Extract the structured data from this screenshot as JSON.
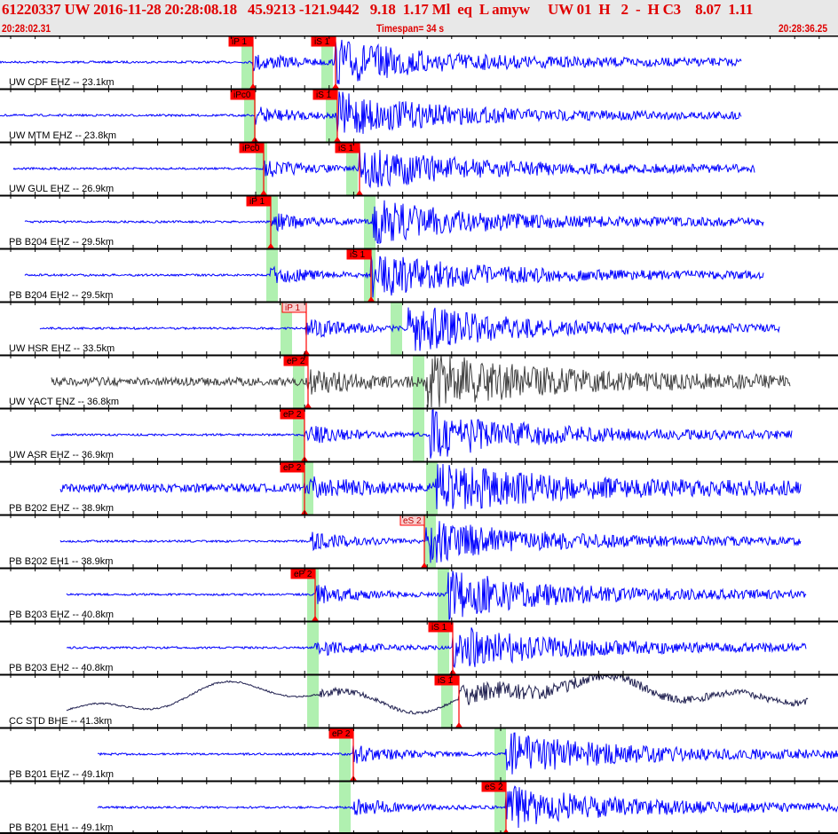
{
  "header": {
    "event_line": "61220337 UW 2016-11-28 20:28:08.18   45.9213 -121.9442   9.18  1.17 Ml  eq  L amyw     UW 01  H   2  -  H C3    8.07  1.11",
    "start_time": "20:28:02.31",
    "timespan": "Timespan=  34 s",
    "end_time": "20:28:36.25"
  },
  "colors": {
    "trace": "#0000ff",
    "trace_gray": "#404040",
    "trace_navy": "#202050",
    "pick": "#ff0000",
    "pick_light": "#f8d0d0",
    "window": "#b0f0b0",
    "header_bg": "#e8e8e8",
    "text": "#e00000"
  },
  "traces": [
    {
      "label": "UW CDF EHZ -- 23.1km",
      "picks": [
        "iP 1",
        "iS 1"
      ]
    },
    {
      "label": "UW MTM EHZ -- 23.8km",
      "picks": [
        "iPc0",
        "iS 1"
      ]
    },
    {
      "label": "UW GUL EHZ -- 26.9km",
      "picks": [
        "iPc0",
        "iS 1"
      ]
    },
    {
      "label": "PB B204 EHZ -- 29.5km",
      "picks": [
        "iP 1"
      ]
    },
    {
      "label": "PB B204 EH2 -- 29.5km",
      "picks": [
        "iS 1"
      ]
    },
    {
      "label": "UW HSR EHZ -- 33.5km",
      "picks": [
        "iP 1"
      ]
    },
    {
      "label": "UW YACT ENZ -- 36.8km",
      "picks": [
        "eP 2"
      ]
    },
    {
      "label": "UW ASR EHZ -- 36.9km",
      "picks": [
        "eP 2"
      ]
    },
    {
      "label": "PB B202 EHZ -- 38.9km",
      "picks": [
        "eP 2"
      ]
    },
    {
      "label": "PB B202 EH1 -- 38.9km",
      "picks": [
        "eS 2"
      ]
    },
    {
      "label": "PB B203 EHZ -- 40.8km",
      "picks": [
        "eP 2"
      ]
    },
    {
      "label": "PB B203 EH2 -- 40.8km",
      "picks": [
        "iS 1"
      ]
    },
    {
      "label": "CC STD BHE -- 41.3km",
      "picks": [
        "iS 1"
      ]
    },
    {
      "label": "PB B201 EHZ -- 49.1km",
      "picks": [
        "eP 2"
      ]
    },
    {
      "label": "PB B201 EH1 -- 49.1km",
      "picks": [
        "eS 2"
      ]
    }
  ]
}
